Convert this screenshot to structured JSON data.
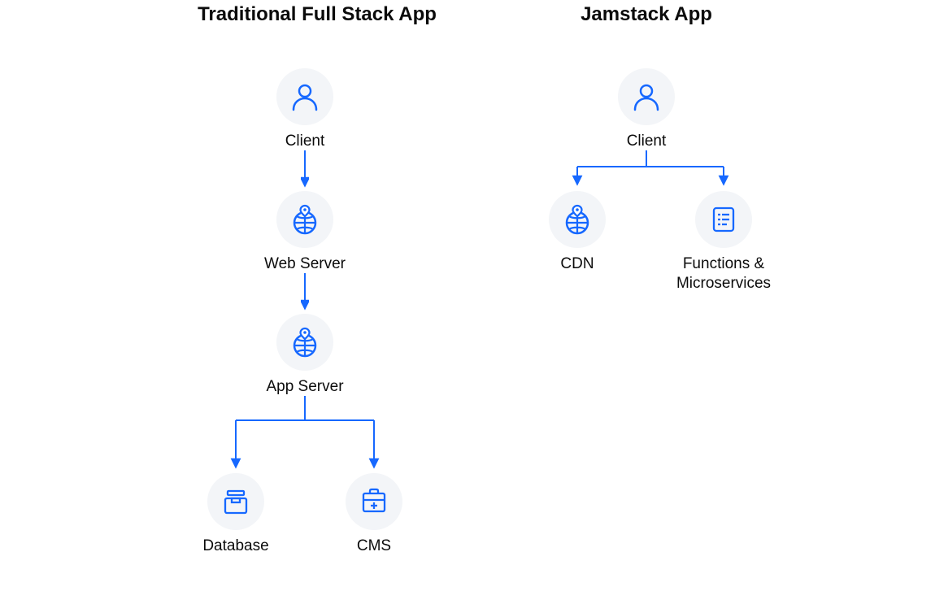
{
  "columns": {
    "left": {
      "title": "Traditional Full Stack App"
    },
    "right": {
      "title": "Jamstack App"
    }
  },
  "left": {
    "client_label": "Client",
    "web_server_label": "Web Server",
    "app_server_label": "App Server",
    "database_label": "Database",
    "cms_label": "CMS"
  },
  "right": {
    "client_label": "Client",
    "cdn_label": "CDN",
    "functions_label": "Functions & Microservices"
  },
  "colors": {
    "accent": "#1668ff",
    "circle_bg": "#f3f5f8"
  }
}
